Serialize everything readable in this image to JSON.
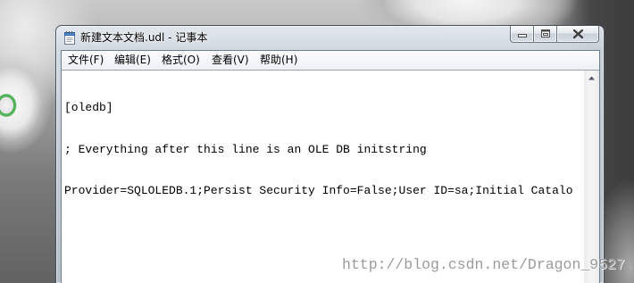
{
  "window": {
    "title": "新建文本文档.udl - 记事本",
    "icon": "notepad-icon",
    "caption_icons": {
      "minimize": "minimize-icon",
      "maximize": "maximize-icon",
      "close": "close-icon"
    }
  },
  "menu": {
    "items": [
      {
        "label": "文件(F)"
      },
      {
        "label": "编辑(E)"
      },
      {
        "label": "格式(O)"
      },
      {
        "label": "查看(V)"
      },
      {
        "label": "帮助(H)"
      }
    ]
  },
  "editor": {
    "lines": [
      "[oledb]",
      "; Everything after this line is an OLE DB initstring",
      "Provider=SQLOLEDB.1;Persist Security Info=False;User ID=sa;Initial Catalo"
    ]
  },
  "scrollbar": {
    "up_arrow_icon": "scroll-up-arrow-icon"
  },
  "watermark": {
    "text": "http://blog.csdn.net/Dragon_9527"
  },
  "colors": {
    "editor_text": "#000000",
    "editor_background": "#ffffff",
    "watermark": "#9b9b9b"
  }
}
